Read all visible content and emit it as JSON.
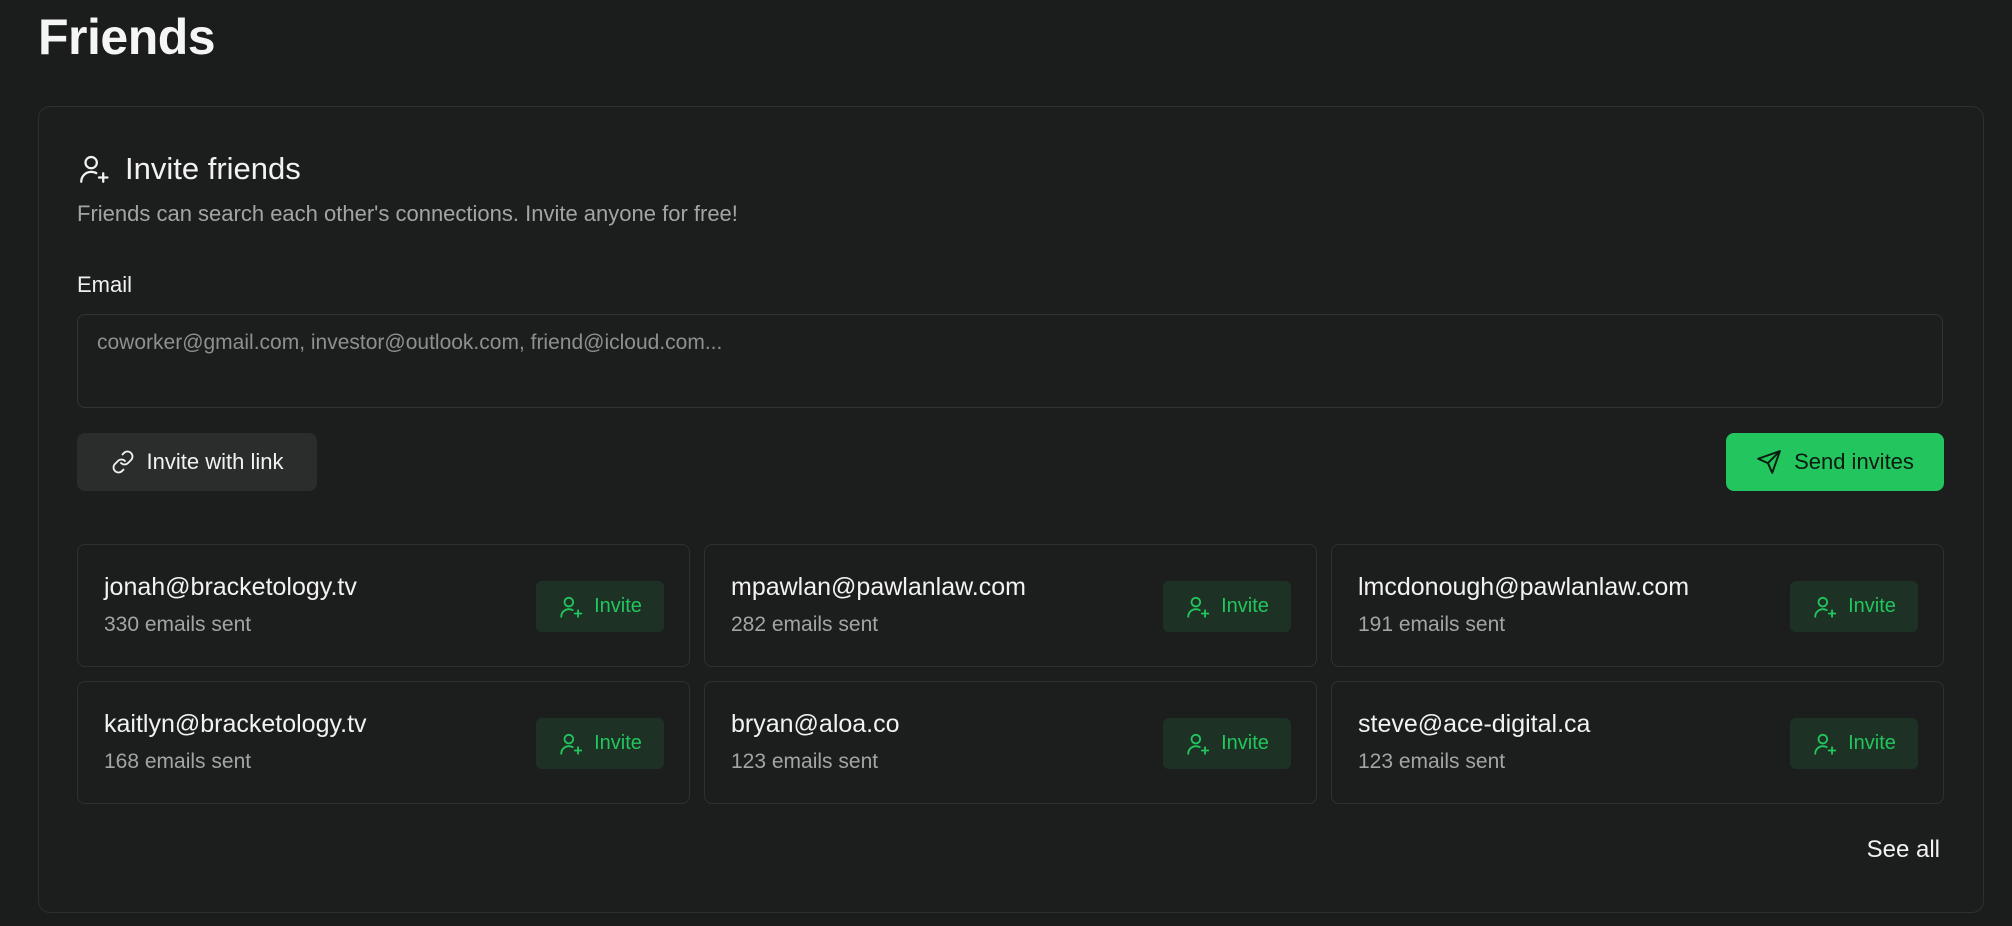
{
  "page": {
    "title": "Friends"
  },
  "invite_card": {
    "title": "Invite friends",
    "title_icon": "user-plus-icon",
    "subtitle": "Friends can search each other's connections. Invite anyone for free!",
    "email_label": "Email",
    "email_placeholder": "coworker@gmail.com, investor@outlook.com, friend@icloud.com...",
    "email_value": "",
    "link_button": {
      "label": "Invite with link",
      "icon": "link-icon"
    },
    "send_button": {
      "label": "Send invites",
      "icon": "send-icon"
    },
    "see_all_label": "See all"
  },
  "friends": [
    {
      "email": "jonah@bracketology.tv",
      "count": "330 emails sent",
      "action": "Invite"
    },
    {
      "email": "mpawlan@pawlanlaw.com",
      "count": "282 emails sent",
      "action": "Invite"
    },
    {
      "email": "lmcdonough@pawlanlaw.com",
      "count": "191 emails sent",
      "action": "Invite"
    },
    {
      "email": "kaitlyn@bracketology.tv",
      "count": "168 emails sent",
      "action": "Invite"
    },
    {
      "email": "bryan@aloa.co",
      "count": "123 emails sent",
      "action": "Invite"
    },
    {
      "email": "steve@ace-digital.ca",
      "count": "123 emails sent",
      "action": "Invite"
    }
  ],
  "colors": {
    "background": "#1b1c1c",
    "accent": "#22c55e",
    "invite_button_bg": "#1d3224",
    "muted_text": "#a3a5a4"
  }
}
